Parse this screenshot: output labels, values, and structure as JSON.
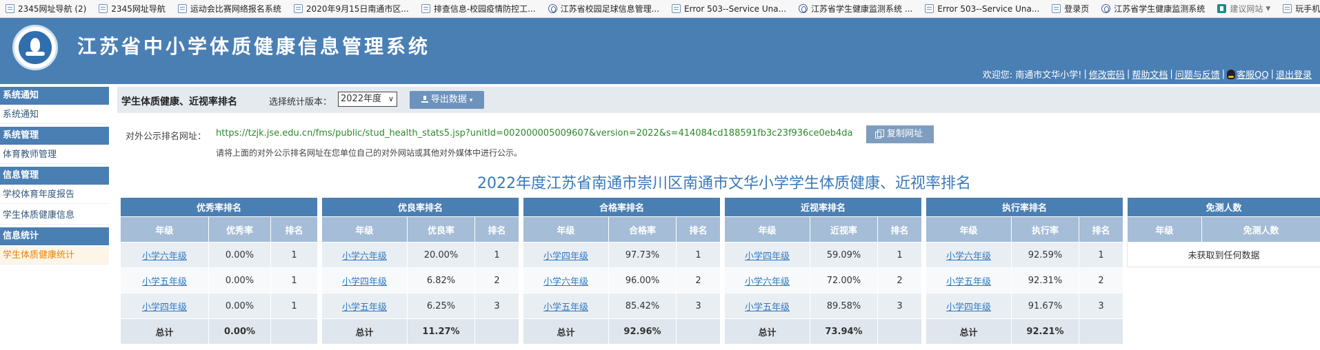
{
  "bookmarks": [
    {
      "label": "2345网址导航 (2)",
      "icon": "page-icon"
    },
    {
      "label": "2345网址导航",
      "icon": "page-icon"
    },
    {
      "label": "运动会比赛网络报名系统",
      "icon": "page-icon"
    },
    {
      "label": "2020年9月15日南通市区...",
      "icon": "page-icon"
    },
    {
      "label": "排查信息-校园疫情防控工...",
      "icon": "page-icon"
    },
    {
      "label": "江苏省校园足球信息管理...",
      "icon": "globe-icon"
    },
    {
      "label": "Error 503--Service Una...",
      "icon": "page-icon"
    },
    {
      "label": "江苏省学生健康监测系统 ...",
      "icon": "globe-icon"
    },
    {
      "label": "Error 503--Service Una...",
      "icon": "page-icon"
    },
    {
      "label": "登录页",
      "icon": "page-icon"
    },
    {
      "label": "江苏省学生健康监测系统",
      "icon": "globe-icon"
    },
    {
      "label": "建议网站",
      "icon": "bing-icon"
    },
    {
      "label": "玩手机游戏",
      "icon": "page-icon"
    }
  ],
  "header": {
    "title": "江苏省中小学体质健康信息管理系统",
    "welcome": "欢迎您: 南通市文华小学!",
    "links": {
      "change_password": "修改密码",
      "help": "帮助文档",
      "feedback": "问题与反馈",
      "service_qq": "客服QQ",
      "logout": "退出登录"
    }
  },
  "sidebar": {
    "groups": [
      {
        "title": "系统通知",
        "items": [
          {
            "label": "系统通知",
            "active": false
          }
        ]
      },
      {
        "title": "系统管理",
        "items": [
          {
            "label": "体育教师管理",
            "active": false
          }
        ]
      },
      {
        "title": "信息管理",
        "items": [
          {
            "label": "学校体育年度报告",
            "active": false
          },
          {
            "label": "学生体质健康信息",
            "active": false
          }
        ]
      },
      {
        "title": "信息统计",
        "items": [
          {
            "label": "学生体质健康统计",
            "active": true
          }
        ]
      }
    ]
  },
  "toolbar": {
    "title": "学生体质健康、近视率排名",
    "version_label": "选择统计版本：",
    "version_value": "2022年度",
    "export_label": "导出数据"
  },
  "public_url": {
    "label": "对外公示排名网址：",
    "value": "https://tzjk.jse.edu.cn/fms/public/stud_health_stats5.jsp?unitId=002000005009607&version=2022&s=414084cd188591fb3c23f936ce0eb4da",
    "copy_label": "复制网址",
    "hint": "请将上面的对外公示排名网址在您单位自己的对外网站或其他对外媒体中进行公示。"
  },
  "ranking": {
    "title": "2022年度江苏省南通市崇川区南通市文华小学学生体质健康、近视率排名",
    "tables": [
      {
        "caption": "优秀率排名",
        "headers": [
          "年级",
          "优秀率",
          "排名"
        ],
        "rows": [
          [
            "小学六年级",
            "0.00%",
            "1"
          ],
          [
            "小学五年级",
            "0.00%",
            "1"
          ],
          [
            "小学四年级",
            "0.00%",
            "1"
          ]
        ],
        "total": [
          "总计",
          "0.00%",
          ""
        ]
      },
      {
        "caption": "优良率排名",
        "headers": [
          "年级",
          "优良率",
          "排名"
        ],
        "rows": [
          [
            "小学六年级",
            "20.00%",
            "1"
          ],
          [
            "小学四年级",
            "6.82%",
            "2"
          ],
          [
            "小学五年级",
            "6.25%",
            "3"
          ]
        ],
        "total": [
          "总计",
          "11.27%",
          ""
        ]
      },
      {
        "caption": "合格率排名",
        "headers": [
          "年级",
          "合格率",
          "排名"
        ],
        "rows": [
          [
            "小学四年级",
            "97.73%",
            "1"
          ],
          [
            "小学六年级",
            "96.00%",
            "2"
          ],
          [
            "小学五年级",
            "85.42%",
            "3"
          ]
        ],
        "total": [
          "总计",
          "92.96%",
          ""
        ]
      },
      {
        "caption": "近视率排名",
        "headers": [
          "年级",
          "近视率",
          "排名"
        ],
        "rows": [
          [
            "小学四年级",
            "59.09%",
            "1"
          ],
          [
            "小学六年级",
            "72.00%",
            "2"
          ],
          [
            "小学五年级",
            "89.58%",
            "3"
          ]
        ],
        "total": [
          "总计",
          "73.94%",
          ""
        ]
      },
      {
        "caption": "执行率排名",
        "headers": [
          "年级",
          "执行率",
          "排名"
        ],
        "rows": [
          [
            "小学六年级",
            "92.59%",
            "1"
          ],
          [
            "小学五年级",
            "92.31%",
            "2"
          ],
          [
            "小学四年级",
            "91.67%",
            "3"
          ]
        ],
        "total": [
          "总计",
          "92.21%",
          ""
        ]
      }
    ],
    "exempt": {
      "caption": "免测人数",
      "headers": [
        "年级",
        "免测人数"
      ],
      "empty_text": "未获取到任何数据"
    }
  }
}
